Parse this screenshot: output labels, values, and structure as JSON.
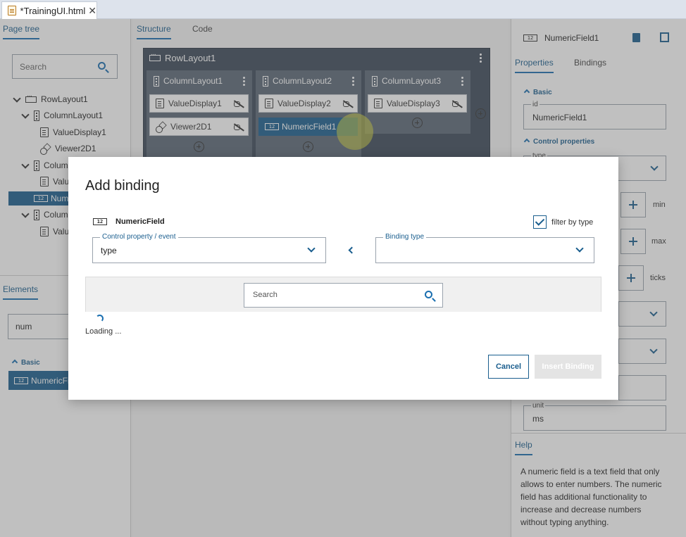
{
  "file_tab": {
    "title": "*TrainingUI.html",
    "close": "✕"
  },
  "left": {
    "tabs": {
      "page_tree": "Page tree",
      "elements": "Elements"
    },
    "tree_search_placeholder": "Search",
    "tree": {
      "row1": "RowLayout1",
      "col1": "ColumnLayout1",
      "vd1": "ValueDisplay1",
      "viewer": "Viewer2D1",
      "col2": "Colum",
      "vd2": "Valu",
      "nf": "Num",
      "col3": "Colum",
      "vd3": "Valu"
    },
    "elements_search_value": "num",
    "basic_label": "Basic",
    "elements_item": "NumericFie"
  },
  "center": {
    "tabs": {
      "structure": "Structure",
      "code": "Code"
    },
    "row_layout": "RowLayout1",
    "columns": [
      {
        "title": "ColumnLayout1",
        "widgets": [
          "ValueDisplay1",
          "Viewer2D1"
        ]
      },
      {
        "title": "ColumnLayout2",
        "widgets": [
          "ValueDisplay2",
          "NumericField1"
        ]
      },
      {
        "title": "ColumnLayout3",
        "widgets": [
          "ValueDisplay3"
        ]
      }
    ]
  },
  "right": {
    "header_title": "NumericField1",
    "tabs": {
      "properties": "Properties",
      "bindings": "Bindings"
    },
    "basic_label": "Basic",
    "id_label": "id",
    "id_value": "NumericField1",
    "control_properties_label": "Control properties",
    "type_label": "type",
    "min_label": "min",
    "max_label": "max",
    "ticks_label": "ticks",
    "unit_label": "unit",
    "unit_value": "ms",
    "help_tab": "Help",
    "help_text": "A numeric field is a text field that only allows to enter numbers. The numeric field has additional functionality to increase and decrease numbers without typing anything."
  },
  "modal": {
    "title": "Add binding",
    "control_name": "NumericField",
    "filter_label": "filter by type",
    "filter_checked": true,
    "control_property_label": "Control property / event",
    "control_property_value": "type",
    "binding_type_label": "Binding type",
    "binding_type_value": "",
    "search_placeholder": "Search",
    "loading_text": "Loading ...",
    "cancel_label": "Cancel",
    "insert_label": "Insert Binding"
  },
  "colors": {
    "accent": "#1a5e8e",
    "dark_panel": "#3c4a59",
    "overlay": "#5a5a5a"
  },
  "icons": [
    "file-html-icon",
    "search-icon",
    "row-layout-icon",
    "column-layout-icon",
    "value-display-icon",
    "viewer-2d-icon",
    "numeric-field-icon",
    "unlink-icon",
    "add-circle-icon",
    "kebab-menu-icon",
    "trash-icon",
    "copy-icon",
    "chevron-down-icon",
    "checkbox-icon",
    "arrow-left-icon",
    "spinner-icon"
  ]
}
